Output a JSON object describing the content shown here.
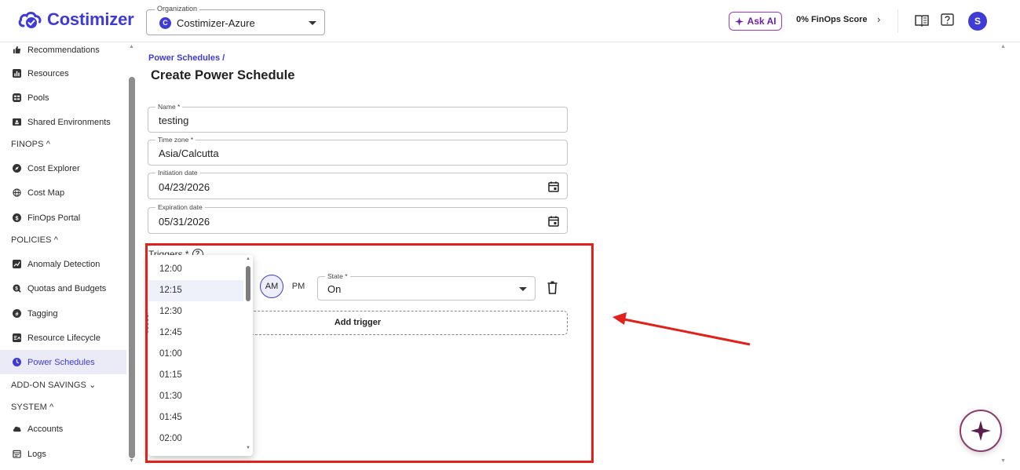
{
  "header": {
    "brand": "Costimizer",
    "organization_label": "Organization",
    "organization_initial": "C",
    "organization_value": "Costimizer-Azure",
    "ask_ai_label": "Ask AI",
    "finops_score_label": "0% FinOps Score",
    "user_initial": "S"
  },
  "sidebar": {
    "items_top": [
      "Recommendations",
      "Resources",
      "Pools",
      "Shared Environments"
    ],
    "section_finops": "FINOPS ^",
    "items_finops": [
      "Cost Explorer",
      "Cost Map",
      "FinOps Portal"
    ],
    "section_policies": "POLICIES ^",
    "items_policies": [
      "Anomaly Detection",
      "Quotas and Budgets",
      "Tagging",
      "Resource Lifecycle",
      "Power Schedules"
    ],
    "section_addon": "ADD-ON SAVINGS ⌄",
    "section_system": "SYSTEM ^",
    "items_system": [
      "Accounts",
      "Logs"
    ],
    "active_item": "Power Schedules"
  },
  "main": {
    "breadcrumb": "Power Schedules  /",
    "title": "Create Power Schedule",
    "fields": {
      "name": {
        "label": "Name *",
        "value": "testing"
      },
      "timezone": {
        "label": "Time zone *",
        "value": "Asia/Calcutta"
      },
      "initiation": {
        "label": "Initiation date",
        "value": "04/23/2026"
      },
      "expiration": {
        "label": "Expiration date",
        "value": "05/31/2026"
      }
    },
    "triggers_label": "Triggers *",
    "am_label": "AM",
    "pm_label": "PM",
    "state_label": "State *",
    "state_value": "On",
    "add_trigger_label": "Add trigger"
  },
  "time_dropdown": {
    "options": [
      "12:00",
      "12:15",
      "12:30",
      "12:45",
      "01:00",
      "01:15",
      "01:30",
      "01:45",
      "02:00"
    ],
    "hovered": "12:15"
  },
  "colors": {
    "brand": "#3d3ad9",
    "annotation_red": "#e2211c",
    "ask_ai_purple": "#6a1fa5"
  }
}
